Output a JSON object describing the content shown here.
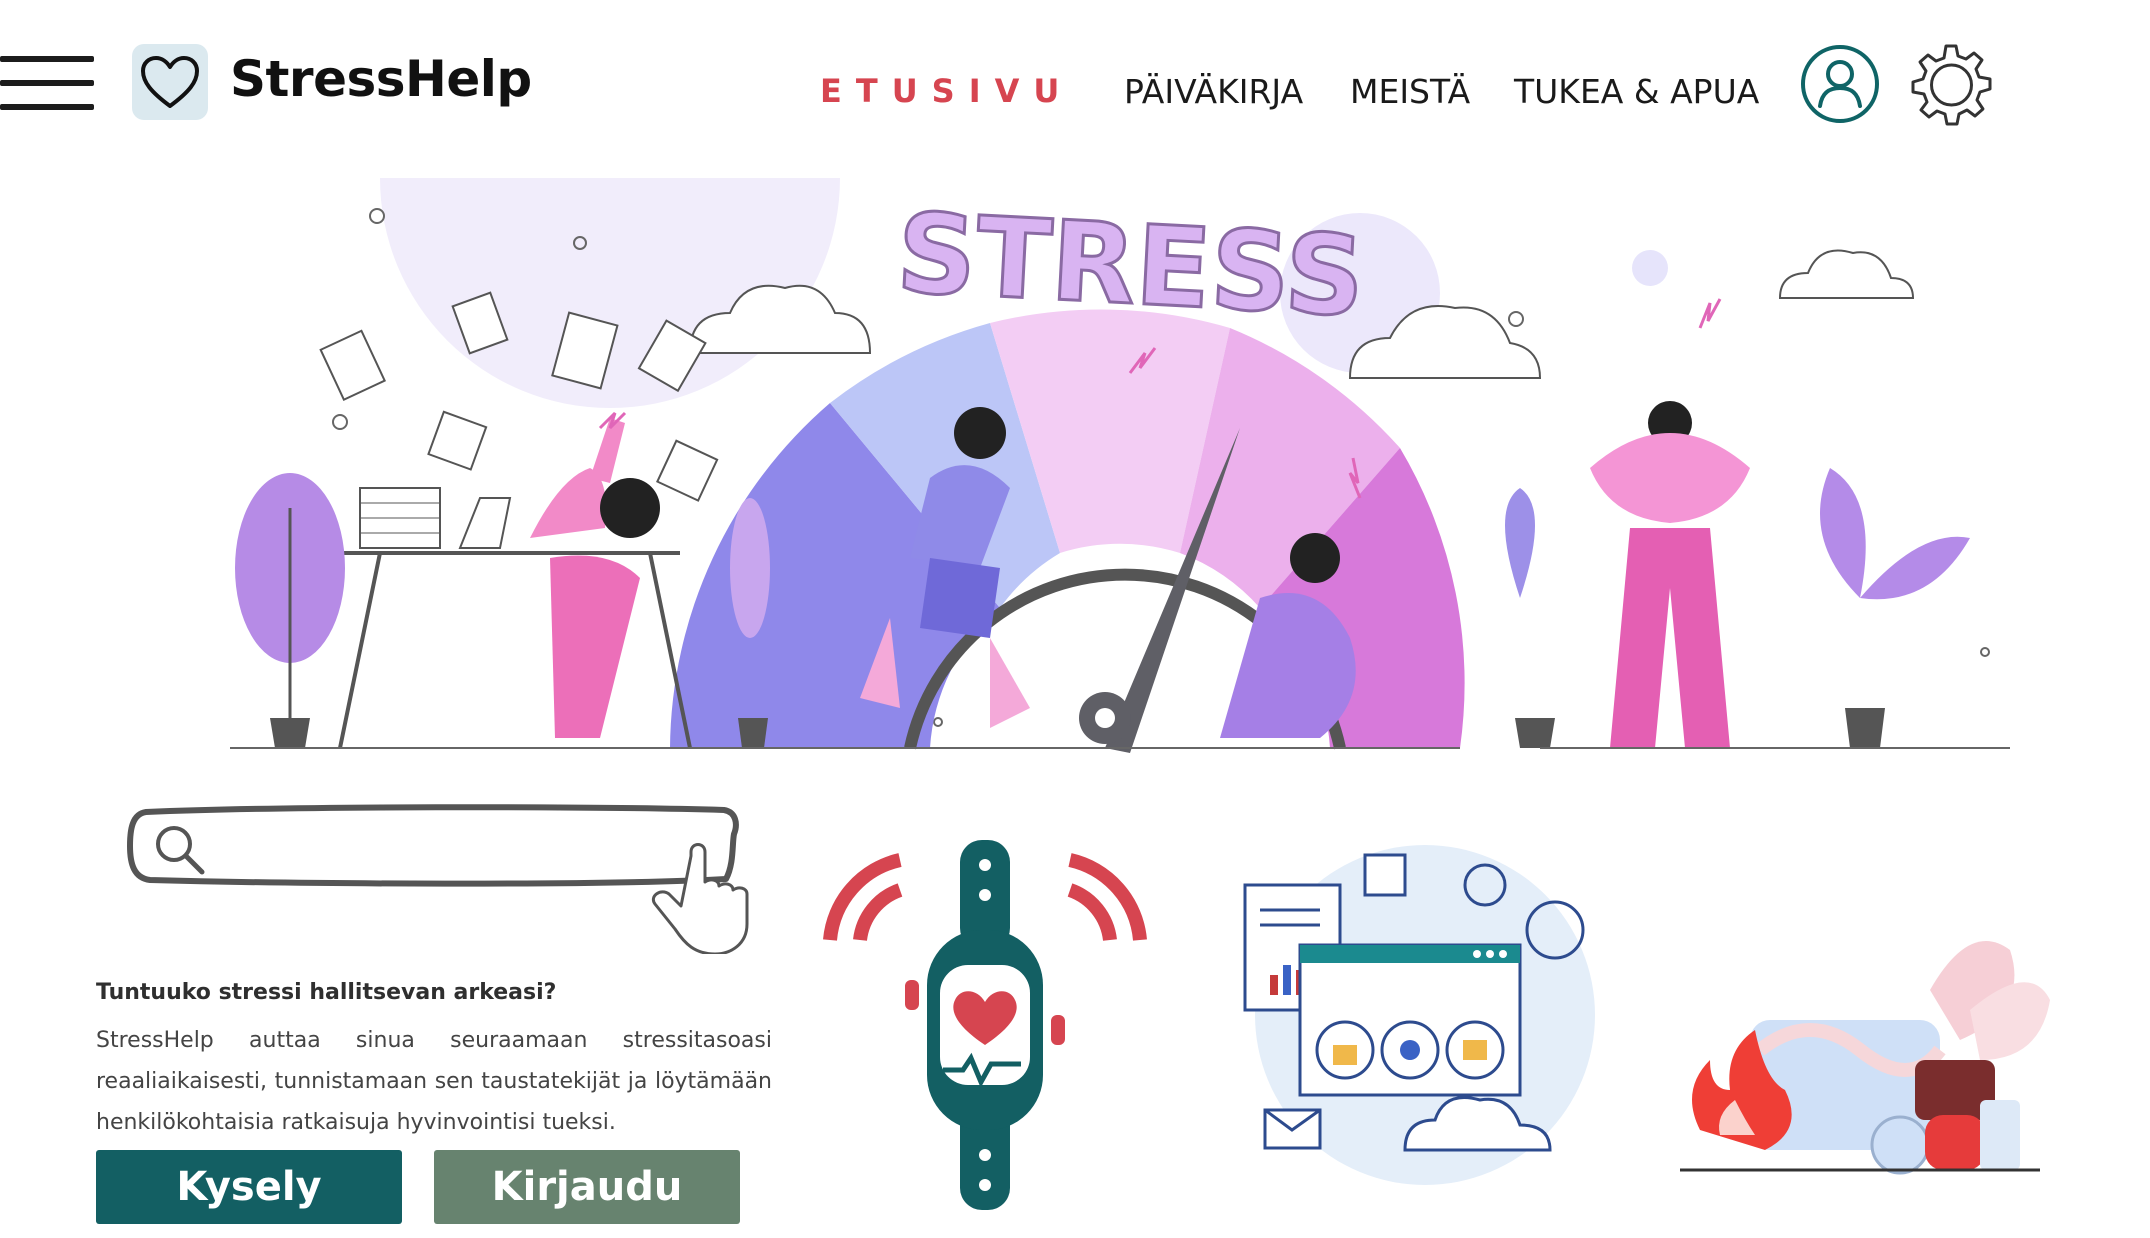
{
  "brand": {
    "name": "StressHelp"
  },
  "nav": {
    "items": [
      {
        "label": "ETUSIVU"
      },
      {
        "label": "PÄIVÄKIRJA"
      },
      {
        "label": "MEISTÄ"
      },
      {
        "label": "TUKEA & APUA"
      }
    ],
    "active_color": "#d64550"
  },
  "hero": {
    "banner_text": "STRESS",
    "accent_color": "#c98be6"
  },
  "search": {
    "placeholder": ""
  },
  "intro": {
    "title": "Tuntuuko stressi hallitsevan arkeasi?",
    "body": "StressHelp auttaa sinua seuraamaan stressitasoasi reaaliaikaisesti, tunnistamaan sen taustatekijät ja löytämään henkilökohtaisia ratkaisuja hyvinvointisi tueksi."
  },
  "buttons": {
    "primary_label": "Kysely",
    "secondary_label": "Kirjaudu",
    "primary_color": "#135f63",
    "secondary_color": "#67836f"
  },
  "icons": [
    "menu-icon",
    "heart-icon",
    "user-icon",
    "gear-icon",
    "search-icon",
    "pointer-hand-icon",
    "smartwatch-heart-icon",
    "data-security-icon",
    "campfire-relax-icon"
  ]
}
